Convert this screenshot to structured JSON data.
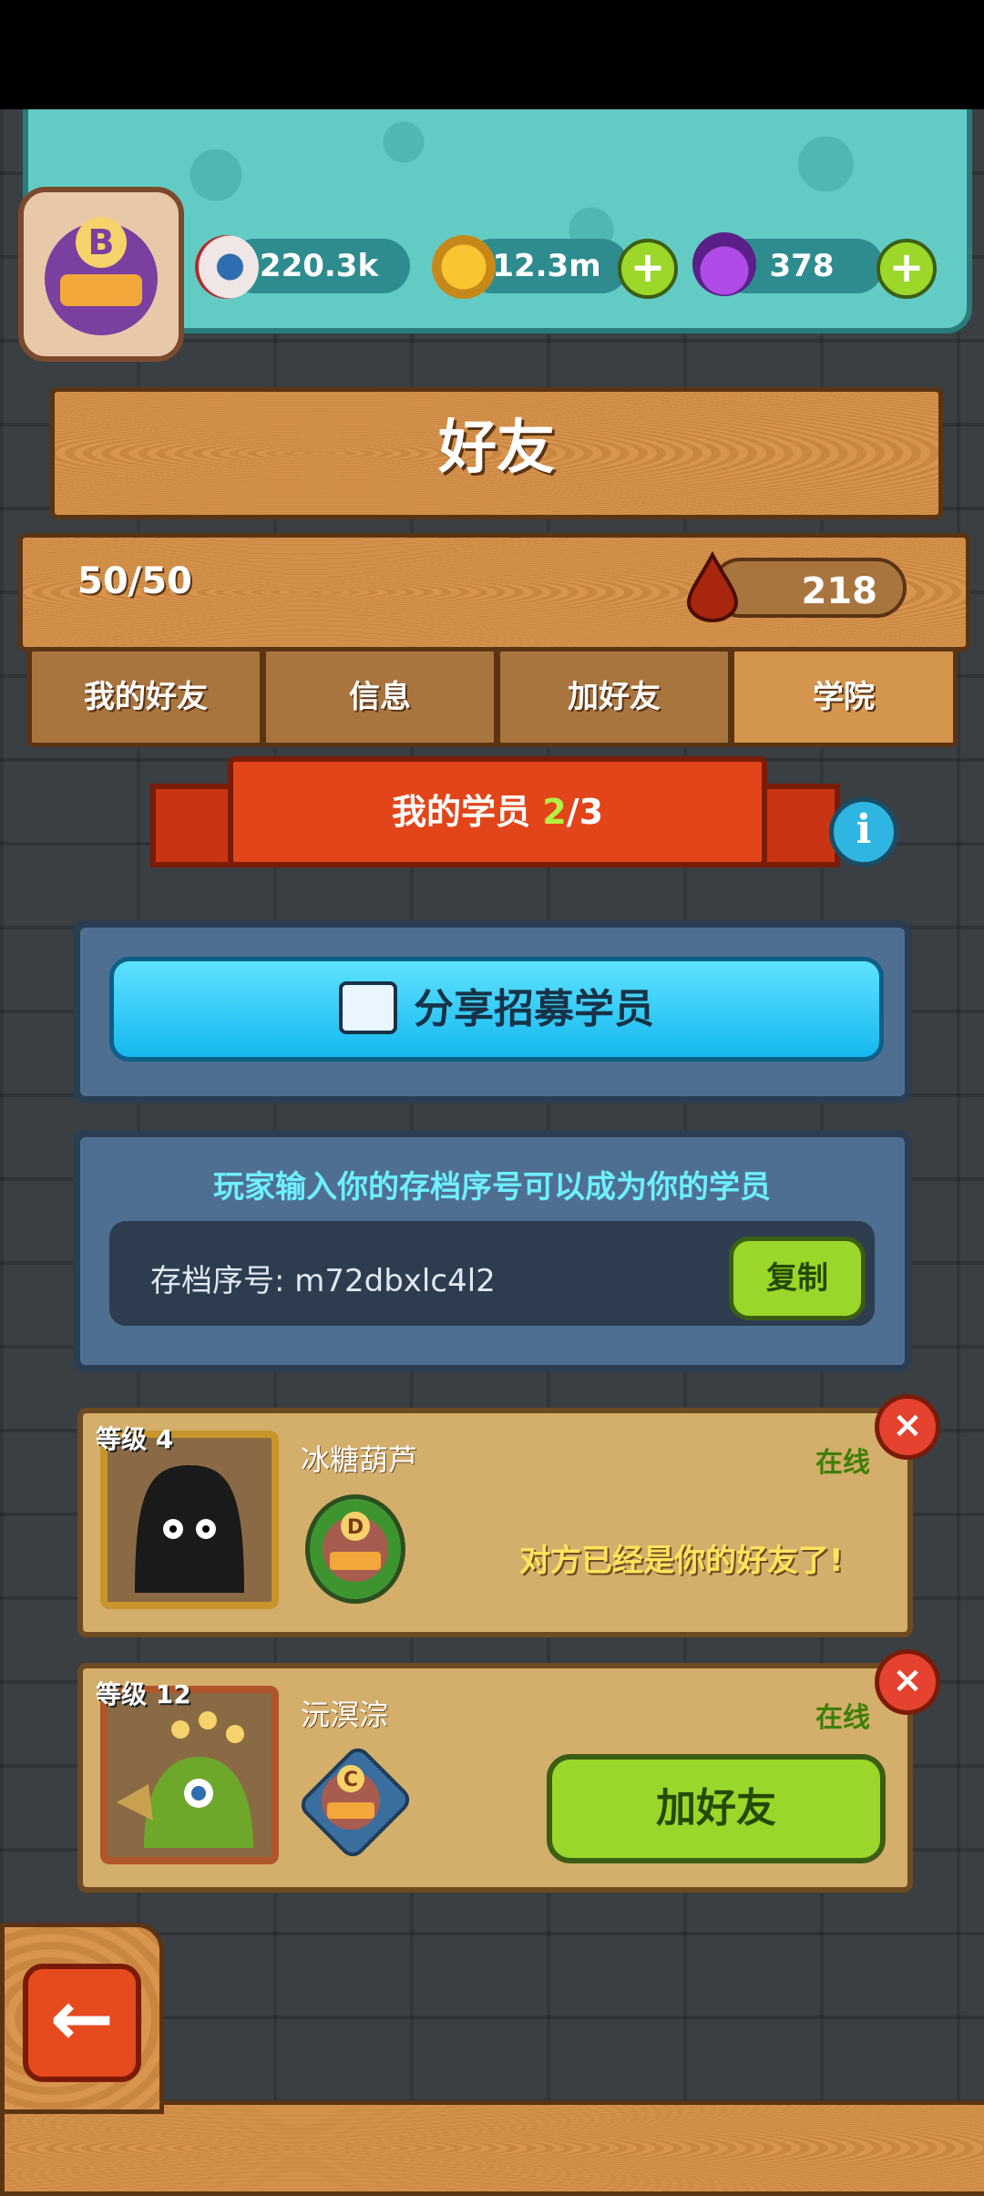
{
  "resources": {
    "eyes": "220.3k",
    "coins": "12.3m",
    "potions": "378",
    "plus": "+"
  },
  "player": {
    "rank": "B"
  },
  "header": {
    "title": "好友"
  },
  "counter": {
    "friends": "50/50",
    "blood": "218"
  },
  "tabs": [
    {
      "label": "我的好友"
    },
    {
      "label": "信息"
    },
    {
      "label": "加好友"
    },
    {
      "label": "学院",
      "active": true
    }
  ],
  "ribbon": {
    "label": "我的学员",
    "current": "2",
    "total": "/3"
  },
  "info_icon": "i",
  "share": {
    "label": "分享招募学员"
  },
  "save": {
    "hint": "玩家输入你的存档序号可以成为你的学员",
    "label": "存档序号: m72dbxlc4l2",
    "copy": "复制"
  },
  "students": [
    {
      "level": "等级 4",
      "name": "冰糖葫芦",
      "status": "在线",
      "rank": "D",
      "message": "对方已经是你的好友了!"
    },
    {
      "level": "等级 12",
      "name": "沅溟淙",
      "status": "在线",
      "rank": "C",
      "button": "加好友"
    }
  ],
  "close_symbol": "×",
  "back_symbol": "←",
  "colors": {
    "accent_green": "#9bd72a",
    "accent_cyan": "#15b8ef",
    "ribbon_red": "#e2451a",
    "wood": "#d4954f"
  }
}
